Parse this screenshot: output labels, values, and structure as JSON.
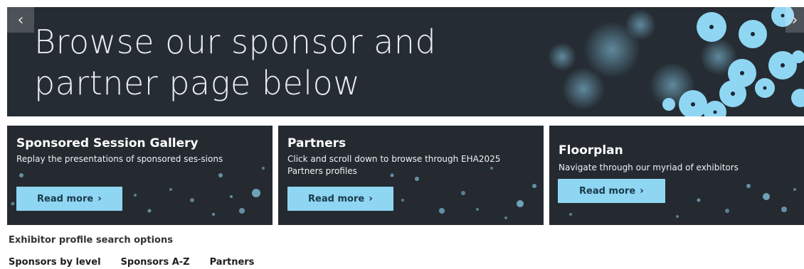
{
  "hero": {
    "title_line1": "Browse our sponsor and",
    "title_line2": "partner page below",
    "prev_icon": "chevron-left-icon",
    "next_icon": "chevron-right-icon",
    "accent_color": "#8fd6f3",
    "background_color": "#252c33"
  },
  "cards": [
    {
      "title": "Sponsored Session Gallery",
      "description": "Replay the presentations of sponsored ses-sions",
      "button_label": "Read more"
    },
    {
      "title": "Partners",
      "description": "Click and scroll down to browse through EHA2025 Partners profiles",
      "button_label": "Read more"
    },
    {
      "title": "Floorplan",
      "description": "Navigate through our myriad of exhibitors",
      "button_label": "Read more"
    }
  ],
  "search": {
    "heading": "Exhibitor profile search options",
    "tabs": [
      "Sponsors by level",
      "Sponsors A-Z",
      "Partners"
    ]
  }
}
